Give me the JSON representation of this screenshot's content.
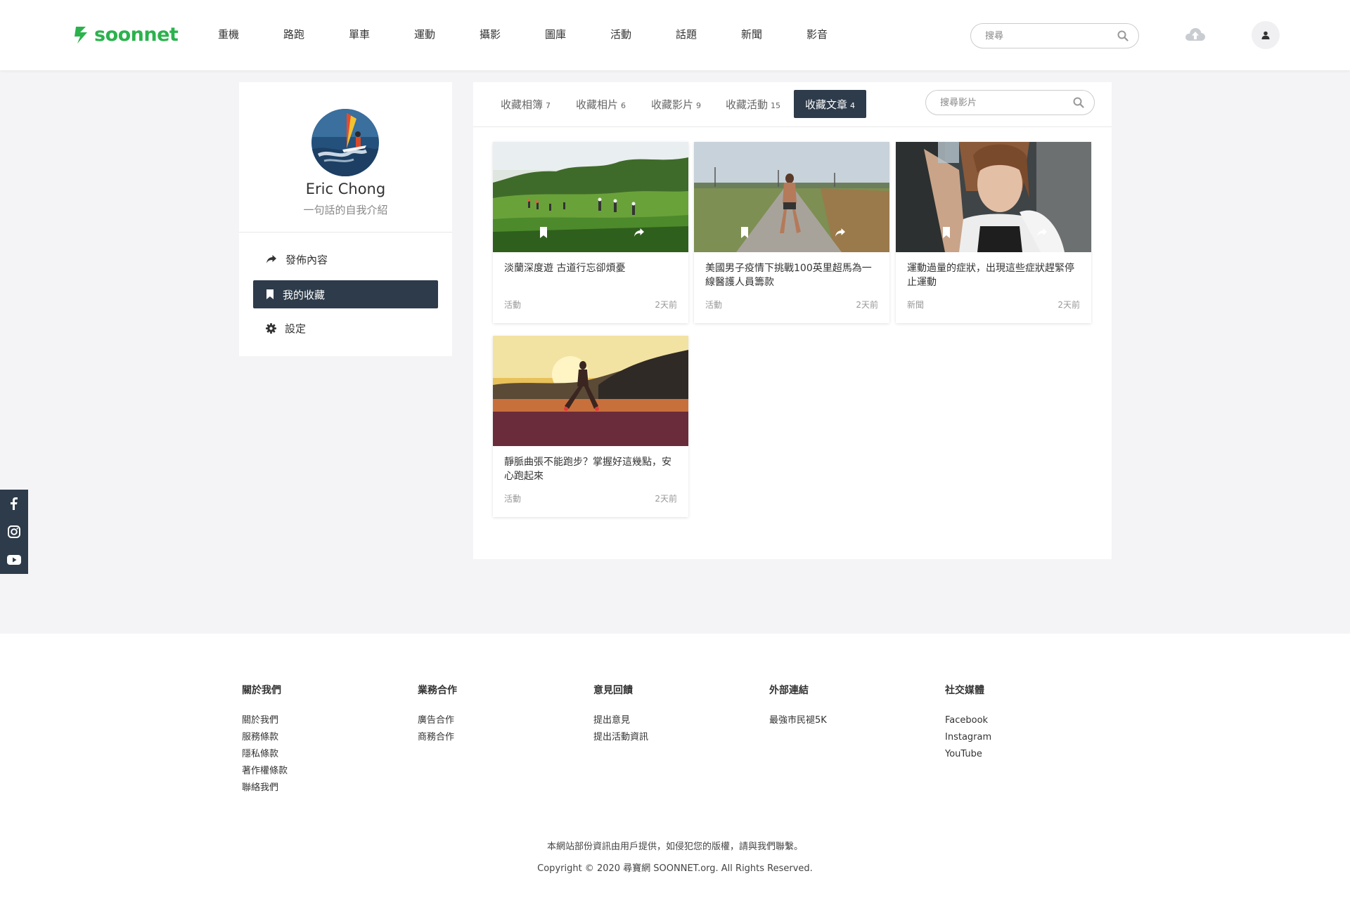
{
  "brand": {
    "name": "soonnet",
    "color": "#2bb24c"
  },
  "nav": [
    "重機",
    "路跑",
    "單車",
    "運動",
    "攝影",
    "圖庫",
    "活動",
    "話題",
    "新聞",
    "影音"
  ],
  "header_search": {
    "placeholder": "搜尋"
  },
  "profile": {
    "name": "Eric Chong",
    "bio": "一句話的自我介紹",
    "menu": [
      {
        "label": "發佈內容",
        "icon": "share-icon"
      },
      {
        "label": "我的收藏",
        "icon": "bookmark-icon",
        "active": true
      },
      {
        "label": "設定",
        "icon": "gear-icon"
      }
    ]
  },
  "tabs": [
    {
      "label": "收藏相簿",
      "count": "7"
    },
    {
      "label": "收藏相片",
      "count": "6"
    },
    {
      "label": "收藏影片",
      "count": "9"
    },
    {
      "label": "收藏活動",
      "count": "15"
    },
    {
      "label": "收藏文章",
      "count": "4",
      "active": true
    }
  ],
  "tab_search": {
    "placeholder": "搜尋影片"
  },
  "cards": [
    {
      "title": "淡蘭深度遊 古道行忘卻煩憂",
      "category": "活動",
      "time": "2天前"
    },
    {
      "title": "美國男子疫情下挑戰100英里超馬為一線醫護人員籌款",
      "category": "活動",
      "time": "2天前"
    },
    {
      "title": "運動過量的症狀，出現這些症狀趕緊停止運動",
      "category": "新聞",
      "time": "2天前"
    },
    {
      "title": "靜脈曲張不能跑步？掌握好這幾點，安心跑起來",
      "category": "活動",
      "time": "2天前"
    }
  ],
  "footer": {
    "columns": [
      {
        "title": "關於我們",
        "links": [
          "關於我們",
          "服務條款",
          "隱私條款",
          "著作權條款",
          "聯絡我們"
        ]
      },
      {
        "title": "業務合作",
        "links": [
          "廣告合作",
          "商務合作"
        ]
      },
      {
        "title": "意見回饋",
        "links": [
          "提出意見",
          "提出活動資訊"
        ]
      },
      {
        "title": "外部連結",
        "links": [
          "最強市民褪5K"
        ]
      },
      {
        "title": "社交媒體",
        "links": [
          "Facebook",
          "Instagram",
          "YouTube"
        ]
      }
    ],
    "note": "本網站部份資訊由用戶提供，如侵犯您的版權，請與我們聯繫。",
    "copyright": "Copyright © 2020 尋寶網 SOONNET.org. All Rights Reserved."
  },
  "colors": {
    "dark": "#2d3b4a",
    "background": "#f4f4f6"
  }
}
